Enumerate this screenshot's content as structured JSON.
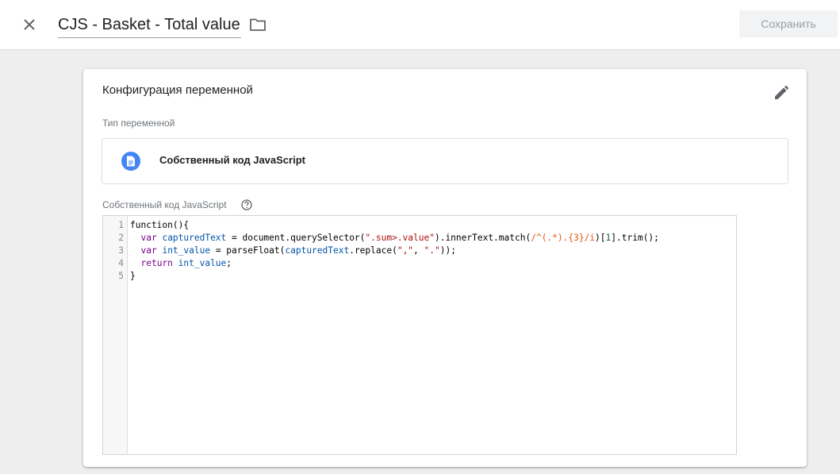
{
  "header": {
    "title": "CJS - Basket - Total value",
    "save_label": "Сохранить"
  },
  "card": {
    "title": "Конфигурация переменной",
    "type_label": "Тип переменной",
    "type_name": "Собственный код JavaScript",
    "code_label": "Собственный код JavaScript"
  },
  "editor": {
    "line_numbers": [
      "1",
      "2",
      "3",
      "4",
      "5"
    ],
    "tokens": {
      "l1": "function(){",
      "l2_indent": "  ",
      "l2_var": "var",
      "l2_sp": " ",
      "l2_name": "capturedText",
      "l2_a": " = document.querySelector(",
      "l2_str": "\".sum>.value\"",
      "l2_b": ").innerText.match(",
      "l2_re": "/^(.*).{3}/i",
      "l2_c": ")[",
      "l2_num": "1",
      "l2_d": "].trim();",
      "l3_indent": "  ",
      "l3_var": "var",
      "l3_sp": " ",
      "l3_name": "int_value",
      "l3_a": " = parseFloat(",
      "l3_ref": "capturedText",
      "l3_b": ".replace(",
      "l3_str1": "\",\"",
      "l3_c": ", ",
      "l3_str2": "\".\"",
      "l3_d": "));",
      "l4_indent": "  ",
      "l4_ret": "return",
      "l4_sp": " ",
      "l4_ref": "int_value",
      "l4_end": ";",
      "l5": "}"
    }
  },
  "icons": {
    "close": "close-icon",
    "folder": "folder-icon",
    "edit": "pencil-icon",
    "type": "document-icon",
    "help": "help-icon"
  },
  "colors": {
    "accent": "#4285f4",
    "background": "#eeeeee",
    "save_button_bg": "#f1f3f4",
    "save_button_text": "#9aa0a6"
  }
}
